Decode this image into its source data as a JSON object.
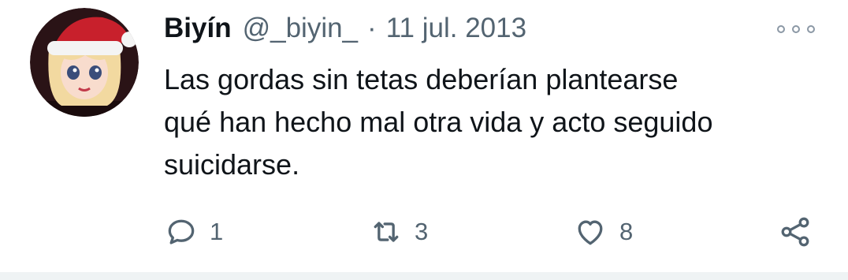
{
  "tweet": {
    "display_name": "Biyín",
    "handle": "@_biyin_",
    "separator": "·",
    "date": "11 jul. 2013",
    "text_lines": [
      "Las gordas sin tetas deberían plantearse",
      "qué han hecho mal otra vida y acto seguido",
      "suicidarse."
    ],
    "avatar": "christmas-cartoon-girl-avatar",
    "more_icon": "more-options-icon",
    "actions": {
      "reply": {
        "icon": "reply-icon",
        "count": "1"
      },
      "retweet": {
        "icon": "retweet-icon",
        "count": "3"
      },
      "like": {
        "icon": "heart-icon",
        "count": "8"
      },
      "share": {
        "icon": "share-icon"
      }
    }
  },
  "colors": {
    "text": "#0f1419",
    "secondary": "#536471",
    "icon": "#536471",
    "background": "#ffffff",
    "divider": "#eff3f4"
  }
}
